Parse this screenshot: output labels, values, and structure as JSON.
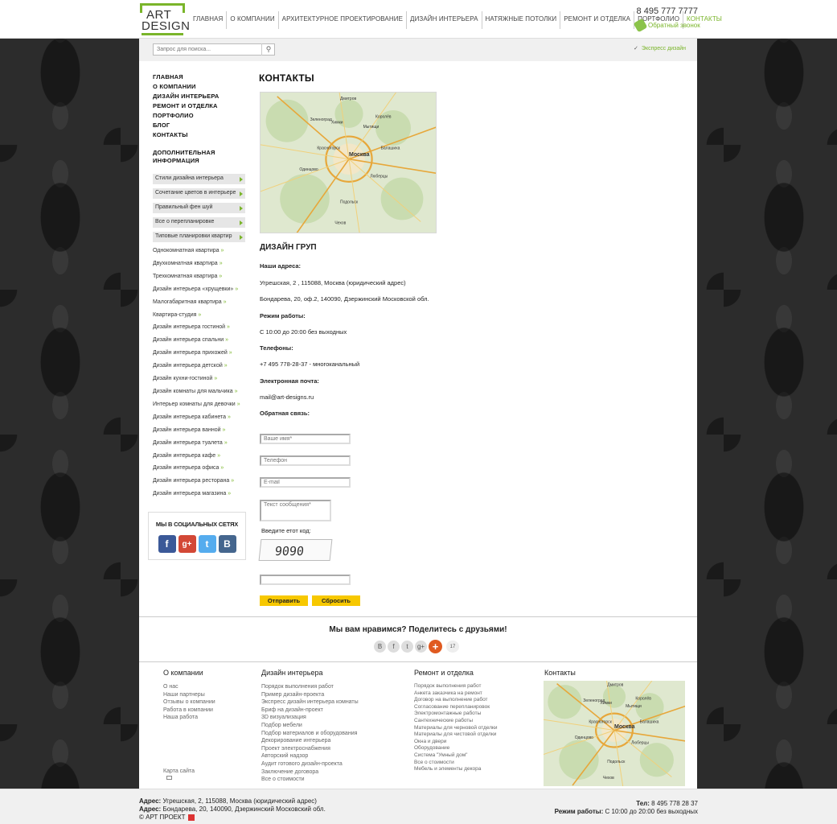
{
  "header": {
    "logo_top": "ART",
    "logo_bottom": "DESIGN",
    "nav": [
      "ГЛАВНАЯ",
      "О КОМПАНИИ",
      "АРХИТЕКТУРНОЕ ПРОЕКТИРОВАНИЕ",
      "ДИЗАЙН ИНТЕРЬЕРА",
      "НАТЯЖНЫЕ ПОТОЛКИ",
      "РЕМОНТ И ОТДЕЛКА",
      "ПОРТФОЛИО",
      "КОНТАКТЫ"
    ],
    "phone": "8 495 777 7777",
    "callback": "Обратный звонок"
  },
  "search": {
    "placeholder": "Запрос для поиска...",
    "express": "Экспресс дизайн"
  },
  "sidebar": {
    "menu": [
      "ГЛАВНАЯ",
      "О КОМПАНИИ",
      "ДИЗАЙН ИНТЕРЬЕРА",
      "РЕМОНТ И ОТДЕЛКА",
      "ПОРТФОЛИО",
      "БЛОГ",
      "КОНТАКТЫ"
    ],
    "addinfo": "ДОПОЛНИТЕЛЬНАЯ ИНФОРМАЦИЯ",
    "boxes": [
      "Стили дизайна интерьера",
      "Сочетание цветов в интерьере",
      "Правильный фен шуй",
      "Все о перепланировке",
      "Типовые планировки квартир"
    ],
    "links": [
      "Однокомнатная квартира",
      "Двухкомнатная квартира",
      "Трехкомнатная квартира",
      "Дизайн интерьера «хрущевки»",
      "Малогабаритная квартира",
      "Квартира-студия",
      "Дизайн интерьера гостиной",
      "Дизайн интерьера спальни",
      "Дизайн интерьера прихожей",
      "Дизайн интерьера детской",
      "Дизайн кухни-гостиной",
      "Дизайн комнаты для мальчика",
      "Интерьер комнаты для девочки",
      "Дизайн интерьера кабинета",
      "Дизайн интерьера ванной",
      "Дизайн интерьера туалета",
      "Дизайн интерьера кафе",
      "Дизайн интерьера офиса",
      "Дизайн интерьера ресторана",
      "Дизайн интерьера магазина"
    ],
    "social_title": "МЫ В СОЦИАЛЬНЫХ СЕТЯХ",
    "social": [
      "f",
      "g+",
      "t",
      "B"
    ]
  },
  "main": {
    "title": "КОНТАКТЫ",
    "company": "ДИЗАЙН ГРУП",
    "addr_label": "Наши адреса:",
    "addr1": "Угрешская, 2 , 115088, Москва (юридический адрес)",
    "addr2": "Бондарева, 20, оф.2, 140090, Дзержинский Московской обл.",
    "hours_label": "Режим работы:",
    "hours": "С 10:00 до 20:00 без выходных",
    "phones_label": "Телефоны:",
    "phones": "+7 495 778-28-37 - многоканальный",
    "email_label": "Электронная почта:",
    "email": "mail@art-designs.ru",
    "feedback_label": "Обратная связь:",
    "name_ph": "Ваше имя*",
    "phone_ph": "Телефон",
    "email_ph": "E-mail",
    "msg_ph": "Текст сообщения*",
    "code_label": "Введите етот код:",
    "captcha": "9090",
    "send": "Отправить",
    "reset": "Сбросить"
  },
  "map_labels": [
    "Москва",
    "Химки",
    "Подольск",
    "Балашиха",
    "Люберцы",
    "Одинцово",
    "Мытищи",
    "Королёв",
    "Чехов",
    "Дмитров",
    "Зеленоград",
    "Красногорск"
  ],
  "share": {
    "title": "Мы вам нравимся? Поделитесь с друзьями!",
    "icons": [
      "В",
      "f",
      "t",
      "g+"
    ],
    "count": "17"
  },
  "footer": {
    "col1_title": "О компании",
    "col1": [
      "О нас",
      "Наши партнеры",
      "Отзывы о компании",
      "Работа в компании",
      "Наша работа"
    ],
    "col2_title": "Дизайн интерьера",
    "col2": [
      "Порядок выполнения работ",
      "Пример дизайн-проекта",
      "Экспресс дизайн интерьера комнаты",
      "Бриф на дизайн-проект",
      "3D визуализация",
      "Подбор мебели",
      "Подбор материалов и оборудования",
      "Декорирование интерьера",
      "Проект электроснабжения",
      "Авторский надзор",
      "Аудит готового дизайн-проекта",
      "Заключение договора",
      "Все о стоимости"
    ],
    "col3_title": "Ремонт и отделка",
    "col3": [
      "Порядок выполнения работ",
      "Анкета заказчика на ремонт",
      "Договор на выполнение работ",
      "Согласование перепланировок",
      "Электромонтажные работы",
      "Сантехнические работы",
      "Материалы для черновой отделки",
      "Материалы для чистовой отделки",
      "Окна и двери",
      "Оборудование",
      "Система \"Умный дом\"",
      "Все о стоимости",
      "Мебель и элементы декора"
    ],
    "col4_title": "Контакты",
    "sitemap": "Карта сайта"
  },
  "bottom": {
    "addr_label1": "Адрес:",
    "addr1": "Угрешская, 2, 115088, Москва (юридический адрес)",
    "addr_label2": "Адрес:",
    "addr2": "Бондарева, 20, 140090, Дзержинский Московский обл.",
    "copyright": "© АРТ ПРОЕКТ",
    "tel_label": "Тел:",
    "tel": "8 495 778 28 37",
    "hours_label": "Режим работы:",
    "hours": "С 10:00 до 20:00 без выходных"
  },
  "colors": {
    "accent": "#7ab52a",
    "button": "#f7c800",
    "bg_dark": "#2c2c2c"
  }
}
